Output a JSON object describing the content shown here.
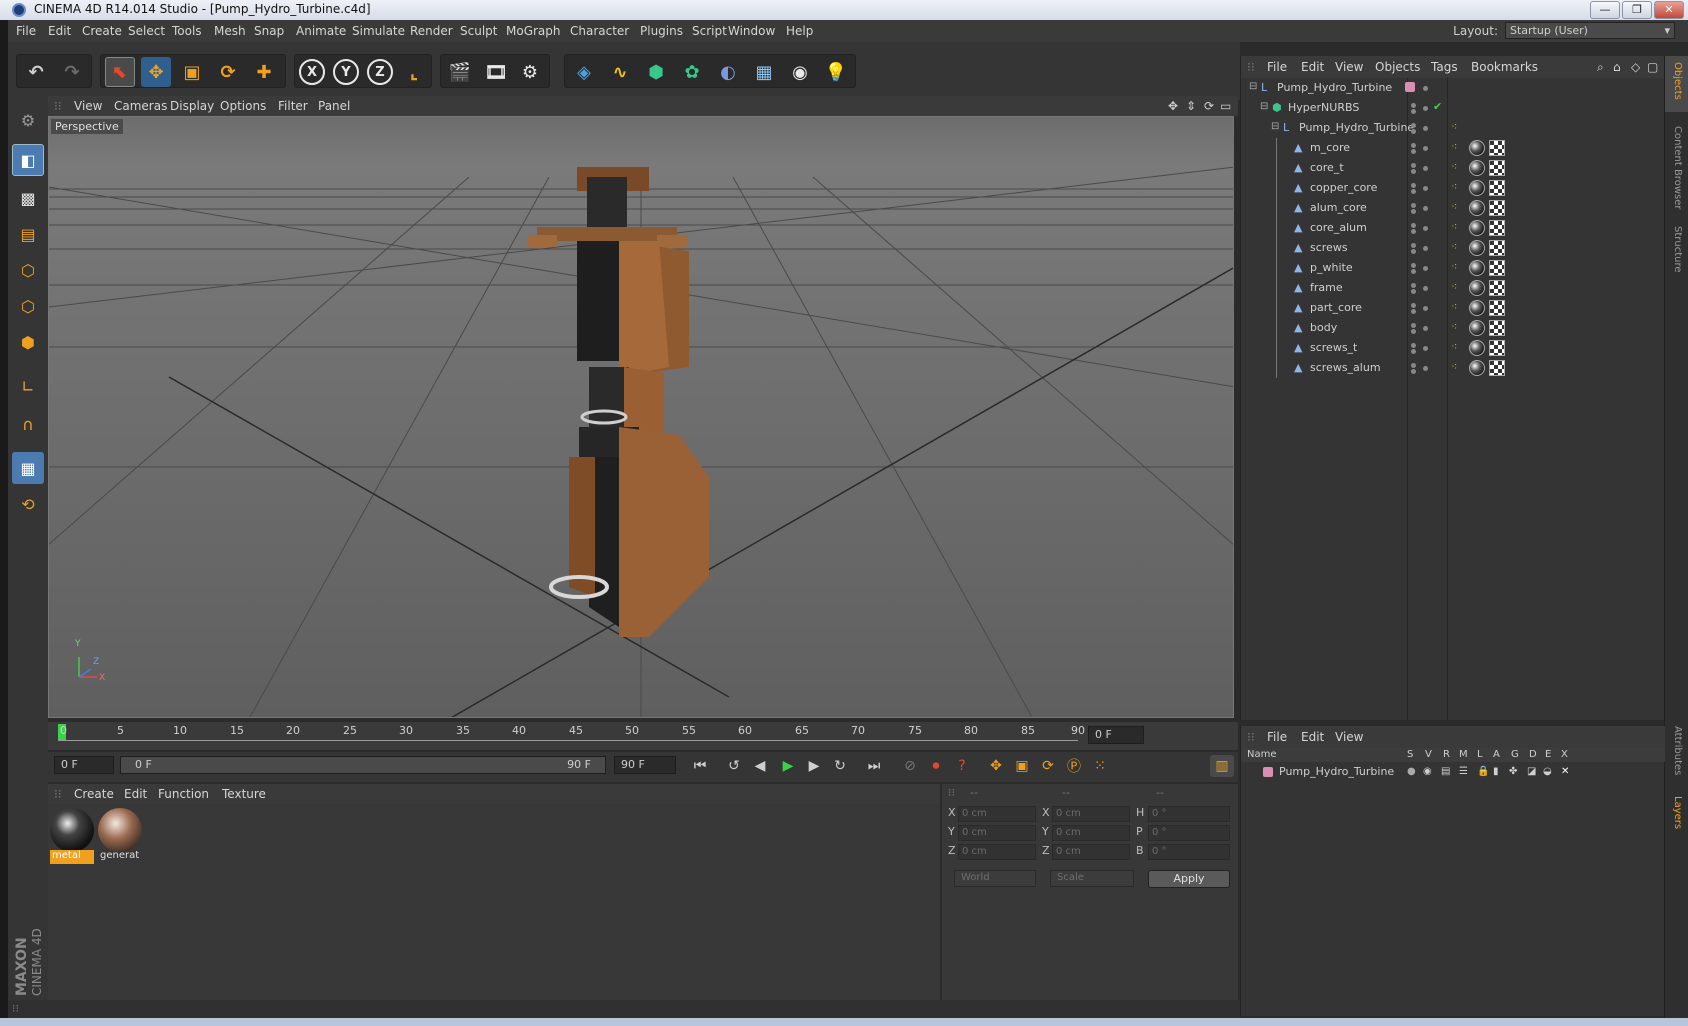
{
  "window": {
    "title": "CINEMA 4D R14.014 Studio - [Pump_Hydro_Turbine.c4d]",
    "minimize_label": "—",
    "restore_label": "❐",
    "close_label": "✕"
  },
  "menubar": {
    "items": [
      "File",
      "Edit",
      "Create",
      "Select",
      "Tools",
      "Mesh",
      "Snap",
      "Animate",
      "Simulate",
      "Render",
      "Sculpt",
      "MoGraph",
      "Character",
      "Plugins",
      "Script",
      "Window",
      "Help"
    ],
    "layout_label": "Layout:",
    "layout_value": "Startup (User)"
  },
  "toolbar": {
    "icons": [
      "undo-icon",
      "redo-icon",
      "live-selection-icon",
      "move-icon",
      "scale-icon",
      "rotate-icon",
      "create-icon",
      "x-axis-icon",
      "y-axis-icon",
      "z-axis-icon",
      "coordinate-system-icon",
      "render-view-icon",
      "render-picture-viewer-icon",
      "render-settings-icon",
      "cube-icon",
      "spline-icon",
      "nurbs-icon",
      "array-icon",
      "deformer-icon",
      "floor-icon",
      "camera-icon",
      "light-icon"
    ],
    "axis_labels": [
      "X",
      "Y",
      "Z"
    ]
  },
  "viewport": {
    "menu": [
      "View",
      "Cameras",
      "Display",
      "Options",
      "Filter",
      "Panel"
    ],
    "label": "Perspective",
    "axis_labels": [
      "Y",
      "Z",
      "X"
    ]
  },
  "timeline": {
    "ticks": [
      "0",
      "5",
      "10",
      "15",
      "20",
      "25",
      "30",
      "35",
      "40",
      "45",
      "50",
      "55",
      "60",
      "65",
      "70",
      "75",
      "80",
      "85",
      "90"
    ],
    "current_frame_field": "0 F",
    "start_field": "0 F",
    "range_start": "0 F",
    "range_end": "90 F",
    "end_field": "90 F"
  },
  "materials": {
    "menu": [
      "Create",
      "Edit",
      "Function",
      "Texture"
    ],
    "items": [
      {
        "name": "metal",
        "selected": true
      },
      {
        "name": "generat",
        "selected": false
      }
    ]
  },
  "coordinates": {
    "header": [
      "--",
      "--",
      "--"
    ],
    "rows": [
      {
        "l1": "X",
        "v1": "0 cm",
        "l2": "X",
        "v2": "0 cm",
        "l3": "H",
        "v3": "0 °"
      },
      {
        "l1": "Y",
        "v1": "0 cm",
        "l2": "Y",
        "v2": "0 cm",
        "l3": "P",
        "v3": "0 °"
      },
      {
        "l1": "Z",
        "v1": "0 cm",
        "l2": "Z",
        "v2": "0 cm",
        "l3": "B",
        "v3": "0 °"
      }
    ],
    "world_select": "World",
    "scale_select": "Scale",
    "apply_label": "Apply"
  },
  "object_manager": {
    "menu": [
      "File",
      "Edit",
      "View",
      "Objects",
      "Tags",
      "Bookmarks"
    ],
    "objects": [
      {
        "name": "Pump_Hydro_Turbine",
        "depth": 0,
        "icon": "null-icon"
      },
      {
        "name": "HyperNURBS",
        "depth": 1,
        "icon": "hypernurbs-icon"
      },
      {
        "name": "Pump_Hydro_Turbine",
        "depth": 2,
        "icon": "null-icon"
      },
      {
        "name": "m_core",
        "depth": 3,
        "icon": "polygon-icon"
      },
      {
        "name": "core_t",
        "depth": 3,
        "icon": "polygon-icon"
      },
      {
        "name": "copper_core",
        "depth": 3,
        "icon": "polygon-icon"
      },
      {
        "name": "alum_core",
        "depth": 3,
        "icon": "polygon-icon"
      },
      {
        "name": "core_alum",
        "depth": 3,
        "icon": "polygon-icon"
      },
      {
        "name": "screws",
        "depth": 3,
        "icon": "polygon-icon"
      },
      {
        "name": "p_white",
        "depth": 3,
        "icon": "polygon-icon"
      },
      {
        "name": "frame",
        "depth": 3,
        "icon": "polygon-icon"
      },
      {
        "name": "part_core",
        "depth": 3,
        "icon": "polygon-icon"
      },
      {
        "name": "body",
        "depth": 3,
        "icon": "polygon-icon"
      },
      {
        "name": "screws_t",
        "depth": 3,
        "icon": "polygon-icon"
      },
      {
        "name": "screws_alum",
        "depth": 3,
        "icon": "polygon-icon"
      }
    ]
  },
  "layer_manager": {
    "menu": [
      "File",
      "Edit",
      "View"
    ],
    "columns": [
      "Name",
      "S",
      "V",
      "R",
      "M",
      "L",
      "A",
      "G",
      "D",
      "E",
      "X"
    ],
    "layers": [
      {
        "name": "Pump_Hydro_Turbine",
        "color": "#d98fb3"
      }
    ]
  },
  "right_tabs": [
    "Objects",
    "Content Browser",
    "Structure",
    "Attributes",
    "Layers"
  ],
  "branding": {
    "maxon": "MAXON",
    "product": "CINEMA 4D"
  },
  "colors": {
    "accent_orange": "#f0a020",
    "accent_blue": "#4aa3df",
    "selection_highlight": "#f0a020"
  }
}
